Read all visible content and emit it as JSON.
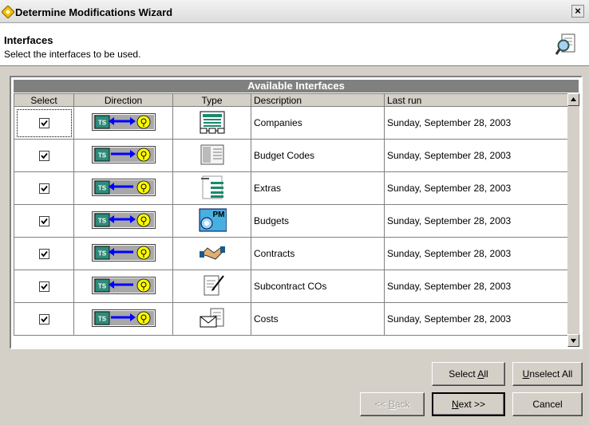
{
  "window": {
    "title": "Determine Modifications Wizard",
    "close_glyph": "×"
  },
  "header": {
    "title": "Interfaces",
    "subtitle": "Select the interfaces to be used."
  },
  "grid": {
    "caption": "Available Interfaces",
    "columns": {
      "select": "Select",
      "direction": "Direction",
      "type": "Type",
      "description": "Description",
      "last_run": "Last run"
    },
    "direction_label": "TS",
    "rows": [
      {
        "selected": true,
        "direction": "both",
        "type_icon": "companies-icon",
        "description": "Companies",
        "last_run": "Sunday, September 28, 2003"
      },
      {
        "selected": true,
        "direction": "out",
        "type_icon": "budget-codes-icon",
        "description": "Budget Codes",
        "last_run": "Sunday, September 28, 2003"
      },
      {
        "selected": true,
        "direction": "in",
        "type_icon": "extras-icon",
        "description": "Extras",
        "last_run": "Sunday, September 28, 2003"
      },
      {
        "selected": true,
        "direction": "both",
        "type_icon": "budgets-icon",
        "description": "Budgets",
        "last_run": "Sunday, September 28, 2003",
        "icon_text": "PM"
      },
      {
        "selected": true,
        "direction": "in",
        "type_icon": "contracts-icon",
        "description": "Contracts",
        "last_run": "Sunday, September 28, 2003"
      },
      {
        "selected": true,
        "direction": "in",
        "type_icon": "subcontract-cos-icon",
        "description": "Subcontract COs",
        "last_run": "Sunday, September 28, 2003"
      },
      {
        "selected": true,
        "direction": "out",
        "type_icon": "costs-icon",
        "description": "Costs",
        "last_run": "Sunday, September 28, 2003"
      }
    ]
  },
  "buttons": {
    "select_all": {
      "pre": "Select ",
      "key": "A",
      "post": "ll"
    },
    "unselect_all": {
      "pre": "",
      "key": "U",
      "post": "nselect All"
    },
    "back": {
      "pre": "<< ",
      "key": "B",
      "post": "ack"
    },
    "next": {
      "pre": "",
      "key": "N",
      "post": "ext >>"
    },
    "cancel": {
      "pre": "",
      "key": "",
      "post": "Cancel"
    }
  },
  "colors": {
    "arrow": "#0000ff",
    "ts_box": "#2e8b7a",
    "badge": "#ffff00",
    "caption_bg": "#808080"
  }
}
